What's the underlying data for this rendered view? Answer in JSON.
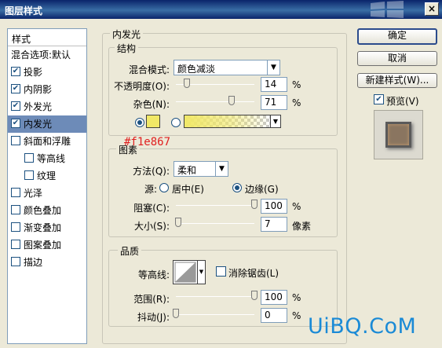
{
  "window": {
    "title": "图层样式",
    "close": "×"
  },
  "stylelist": {
    "header": "样式",
    "items": [
      {
        "label": "混合选项:默认",
        "checkbox": false,
        "checked": false,
        "indent": 0
      },
      {
        "label": "投影",
        "checkbox": true,
        "checked": true,
        "indent": 0
      },
      {
        "label": "内阴影",
        "checkbox": true,
        "checked": true,
        "indent": 0
      },
      {
        "label": "外发光",
        "checkbox": true,
        "checked": true,
        "indent": 0
      },
      {
        "label": "内发光",
        "checkbox": true,
        "checked": true,
        "indent": 0,
        "selected": true
      },
      {
        "label": "斜面和浮雕",
        "checkbox": true,
        "checked": false,
        "indent": 0
      },
      {
        "label": "等高线",
        "checkbox": true,
        "checked": false,
        "indent": 1
      },
      {
        "label": "纹理",
        "checkbox": true,
        "checked": false,
        "indent": 1
      },
      {
        "label": "光泽",
        "checkbox": true,
        "checked": false,
        "indent": 0
      },
      {
        "label": "颜色叠加",
        "checkbox": true,
        "checked": false,
        "indent": 0
      },
      {
        "label": "渐变叠加",
        "checkbox": true,
        "checked": false,
        "indent": 0
      },
      {
        "label": "图案叠加",
        "checkbox": true,
        "checked": false,
        "indent": 0
      },
      {
        "label": "描边",
        "checkbox": true,
        "checked": false,
        "indent": 0
      }
    ]
  },
  "panel": {
    "title": "内发光",
    "structure": {
      "title": "结构",
      "blend_mode_label": "混合模式:",
      "blend_mode_value": "颜色减淡",
      "opacity_label": "不透明度(O):",
      "opacity_value": "14",
      "opacity_pct": 14,
      "noise_label": "杂色(N):",
      "noise_value": "71",
      "noise_pct": 71,
      "unit_pct": "%",
      "swatch_color": "#f1e867"
    },
    "elements": {
      "title": "图素",
      "method_label": "方法(Q):",
      "method_value": "柔和",
      "source_label": "源:",
      "source_center": "居中(E)",
      "source_edge": "边缘(G)",
      "choke_label": "阻塞(C):",
      "choke_value": "100",
      "choke_pct": 100,
      "size_label": "大小(S):",
      "size_value": "7",
      "size_pct": 3,
      "size_unit": "像素",
      "unit_pct": "%"
    },
    "quality": {
      "title": "品质",
      "contour_label": "等高线:",
      "antialias_label": "消除锯齿(L)",
      "range_label": "范围(R):",
      "range_value": "100",
      "range_pct": 100,
      "jitter_label": "抖动(J):",
      "jitter_value": "0",
      "jitter_pct": 0,
      "unit_pct": "%"
    }
  },
  "buttons": {
    "ok": "确定",
    "cancel": "取消",
    "new_style": "新建样式(W)...",
    "preview_label": "预览(V)"
  },
  "annotation": "#f1e867",
  "watermark": "UiBQ.CoM"
}
